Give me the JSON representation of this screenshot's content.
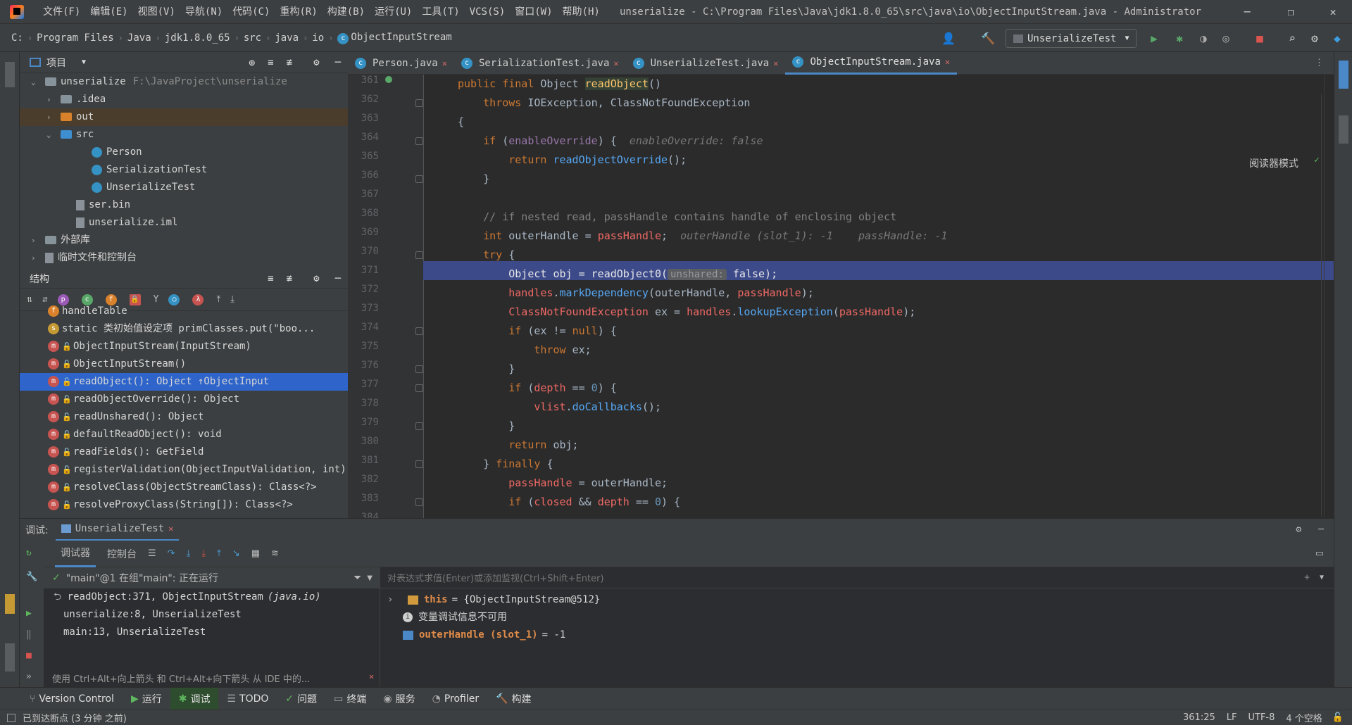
{
  "menu": [
    "文件(F)",
    "编辑(E)",
    "视图(V)",
    "导航(N)",
    "代码(C)",
    "重构(R)",
    "构建(B)",
    "运行(U)",
    "工具(T)",
    "VCS(S)",
    "窗口(W)",
    "帮助(H)"
  ],
  "window_title": "unserialize - C:\\Program Files\\Java\\jdk1.8.0_65\\src\\java\\io\\ObjectInputStream.java - Administrator",
  "breadcrumbs": [
    "C:",
    "Program Files",
    "Java",
    "jdk1.8.0_65",
    "src",
    "java",
    "io",
    "ObjectInputStream"
  ],
  "run_config": "UnserializeTest",
  "project": {
    "title": "项目",
    "items": [
      {
        "label": "unserialize",
        "extra": "F:\\JavaProject\\unserialize",
        "indent": 0,
        "arrow": "⌄",
        "icon": "folder"
      },
      {
        "label": ".idea",
        "extra": "",
        "indent": 1,
        "arrow": "›",
        "icon": "folder"
      },
      {
        "label": "out",
        "extra": "",
        "indent": 1,
        "arrow": "›",
        "icon": "folder-orange"
      },
      {
        "label": "src",
        "extra": "",
        "indent": 1,
        "arrow": "⌄",
        "icon": "folder-blue"
      },
      {
        "label": "Person",
        "extra": "",
        "indent": 3,
        "arrow": "",
        "icon": "class"
      },
      {
        "label": "SerializationTest",
        "extra": "",
        "indent": 3,
        "arrow": "",
        "icon": "class"
      },
      {
        "label": "UnserializeTest",
        "extra": "",
        "indent": 3,
        "arrow": "",
        "icon": "class"
      },
      {
        "label": "ser.bin",
        "extra": "",
        "indent": 2,
        "arrow": "",
        "icon": "file"
      },
      {
        "label": "unserialize.iml",
        "extra": "",
        "indent": 2,
        "arrow": "",
        "icon": "file"
      },
      {
        "label": "外部库",
        "extra": "",
        "indent": 0,
        "arrow": "›",
        "icon": "lib"
      },
      {
        "label": "临时文件和控制台",
        "extra": "",
        "indent": 0,
        "arrow": "›",
        "icon": "scratch"
      }
    ]
  },
  "structure": {
    "title": "结构",
    "items": [
      {
        "label": "handleTable",
        "lock": false,
        "icon": "f"
      },
      {
        "label": "static 类初始值设定项  primClasses.put(\"boo...",
        "lock": false,
        "icon": "s"
      },
      {
        "label": "ObjectInputStream(InputStream)",
        "lock": true,
        "icon": "m"
      },
      {
        "label": "ObjectInputStream()",
        "lock": true,
        "icon": "m"
      },
      {
        "label": "readObject(): Object ↑ObjectInput",
        "lock": true,
        "icon": "m",
        "selected": true
      },
      {
        "label": "readObjectOverride(): Object",
        "lock": true,
        "icon": "m"
      },
      {
        "label": "readUnshared(): Object",
        "lock": true,
        "icon": "m"
      },
      {
        "label": "defaultReadObject(): void",
        "lock": true,
        "icon": "m"
      },
      {
        "label": "readFields(): GetField",
        "lock": true,
        "icon": "m"
      },
      {
        "label": "registerValidation(ObjectInputValidation, int)",
        "lock": true,
        "icon": "m"
      },
      {
        "label": "resolveClass(ObjectStreamClass): Class<?>",
        "lock": true,
        "icon": "m"
      },
      {
        "label": "resolveProxyClass(String[]): Class<?>",
        "lock": true,
        "icon": "m"
      }
    ]
  },
  "tabs": [
    {
      "label": "Person.java",
      "active": false
    },
    {
      "label": "SerializationTest.java",
      "active": false
    },
    {
      "label": "UnserializeTest.java",
      "active": false
    },
    {
      "label": "ObjectInputStream.java",
      "active": true
    }
  ],
  "reader_mode": "阅读器模式",
  "line_numbers": [
    "361",
    "362",
    "363",
    "364",
    "365",
    "366",
    "367",
    "368",
    "369",
    "370",
    "371",
    "372",
    "373",
    "374",
    "375",
    "376",
    "377",
    "378",
    "379",
    "380",
    "381",
    "382",
    "383",
    "384"
  ],
  "debug": {
    "label": "调试:",
    "session": "UnserializeTest",
    "tab_debugger": "调试器",
    "tab_console": "控制台",
    "thread": "\"main\"@1 在组\"main\": 正在运行",
    "frames": [
      {
        "text": "readObject:371, ObjectInputStream",
        "pkg": "(java.io)"
      },
      {
        "text": "unserialize:8, UnserializeTest",
        "pkg": ""
      },
      {
        "text": "main:13, UnserializeTest",
        "pkg": ""
      }
    ],
    "hint": "使用 Ctrl+Alt+向上箭头 和 Ctrl+Alt+向下箭头 从 IDE 中的...",
    "eval_placeholder": "对表达式求值(Enter)或添加监视(Ctrl+Shift+Enter)",
    "vars": [
      {
        "name": "this",
        "value": "= {ObjectInputStream@512}"
      },
      {
        "name": "",
        "value": "变量调试信息不可用"
      },
      {
        "name": "outerHandle (slot_1)",
        "value": "= -1"
      }
    ]
  },
  "bottom_tabs": [
    "Version Control",
    "运行",
    "调试",
    "TODO",
    "问题",
    "终端",
    "服务",
    "Profiler",
    "构建"
  ],
  "status": {
    "left": "已到达断点 (3 分钟 之前)",
    "position": "361:25",
    "line_sep": "LF",
    "encoding": "UTF-8",
    "indent": "4 个空格"
  }
}
